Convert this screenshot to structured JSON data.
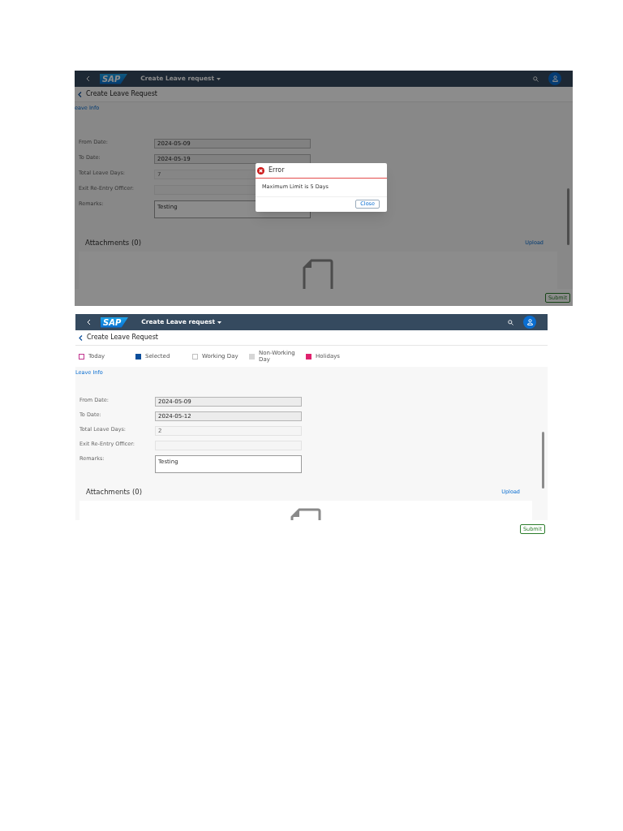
{
  "screenshots": [
    {
      "shell": {
        "logo": "SAP",
        "title": "Create Leave request"
      },
      "page_title": "Create Leave Request",
      "section_link": "eave Info",
      "fields": [
        {
          "label": "From Date:",
          "value": "2024-05-09",
          "kind": "date"
        },
        {
          "label": "To Date:",
          "value": "2024-05-19",
          "kind": "date"
        },
        {
          "label": "Total Leave Days:",
          "value": "7",
          "kind": "readonly"
        },
        {
          "label": "Exit Re-Entry Officer:",
          "kind": "readonly"
        },
        {
          "label": "Remarks:",
          "value": "Testing",
          "kind": "textarea"
        }
      ],
      "attachments_title": "Attachments (0)",
      "upload": "Upload",
      "submit": "Submit",
      "dialog": {
        "title": "Error",
        "message": "Maximum Limit is 5 Days",
        "button": "Close"
      }
    },
    {
      "shell": {
        "logo": "SAP",
        "title": "Create Leave request"
      },
      "page_title": "Create Leave Request",
      "legend": [
        {
          "label": "Today",
          "kind": "outline",
          "color": "#c2338f"
        },
        {
          "label": "Selected",
          "kind": "filled",
          "color": "#0b4e9b"
        },
        {
          "label": "Working Day",
          "kind": "outline",
          "color": "#bfbfbf"
        },
        {
          "label": "Non-Working Day",
          "kind": "filled",
          "color": "#d6d6d6"
        },
        {
          "label": "Holidays",
          "kind": "filled",
          "color": "#e0226e"
        }
      ],
      "section_link": "Leave Info",
      "fields": [
        {
          "label": "From Date:",
          "value": "2024-05-09",
          "kind": "date"
        },
        {
          "label": "To Date:",
          "value": "2024-05-12",
          "kind": "date"
        },
        {
          "label": "Total Leave Days:",
          "value": "2",
          "kind": "readonly"
        },
        {
          "label": "Exit Re-Entry Officer:",
          "kind": "readonly"
        },
        {
          "label": "Remarks:",
          "value": "Testing",
          "kind": "textarea"
        }
      ],
      "attachments_title": "Attachments (0)",
      "upload": "Upload",
      "submit": "Submit"
    }
  ]
}
